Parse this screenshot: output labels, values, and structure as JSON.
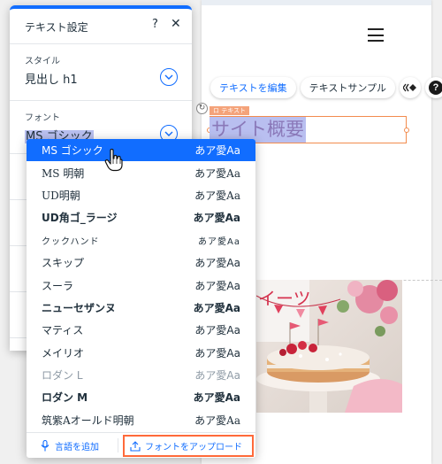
{
  "panel": {
    "title": "テキスト設定",
    "help_label": "?",
    "close_label": "✕",
    "style_section": {
      "label": "スタイル",
      "value": "見出し h1"
    },
    "font_section": {
      "label": "フォント",
      "value": "MS ゴシック"
    }
  },
  "dropdown": {
    "fonts": [
      {
        "name": "MS ゴシック",
        "sample": "あア愛Aa",
        "selected": true
      },
      {
        "name": "MS 明朝",
        "sample": "あア愛Aa"
      },
      {
        "name": "UD明朝",
        "sample": "あア愛Aa"
      },
      {
        "name": "UD角ゴ_ラージ",
        "sample": "あア愛Aa"
      },
      {
        "name": "クックハンド",
        "sample": "あア愛Aa"
      },
      {
        "name": "スキップ",
        "sample": "あア愛Aa"
      },
      {
        "name": "スーラ",
        "sample": "あア愛Aa"
      },
      {
        "name": "ニューセザンヌ",
        "sample": "あア愛Aa"
      },
      {
        "name": "マティス",
        "sample": "あア愛Aa"
      },
      {
        "name": "メイリオ",
        "sample": "あア愛Aa"
      },
      {
        "name": "ロダン L",
        "sample": "あア愛Aa"
      },
      {
        "name": "ロダン M",
        "sample": "あア愛Aa"
      },
      {
        "name": "筑紫Aオールド明朝",
        "sample": "あア愛Aa"
      }
    ],
    "footer": {
      "add_language": "言語を追加",
      "upload_font": "フォントをアップロード"
    }
  },
  "canvas": {
    "toolbar": {
      "edit_text": "テキストを編集",
      "text_sample": "テキストサンプル",
      "help_label": "?"
    },
    "element_tag": "ロ テキスト",
    "heading_text": "サイト概要",
    "photo_overlay_text": "イーツ"
  },
  "colors": {
    "accent": "#116dff",
    "selection_orange": "#f28c4e",
    "highlight_text": "#b9c0f0",
    "upload_border": "#ff6a3a"
  },
  "icons": {
    "style_chevron": "chevron-down-icon",
    "font_chevron": "chevron-down-icon",
    "add_language": "microphone-icon",
    "upload_font": "upload-icon",
    "cursor": "hand-pointer-icon",
    "menu": "hamburger-menu-icon",
    "animation": "diamond-arrows-icon"
  }
}
